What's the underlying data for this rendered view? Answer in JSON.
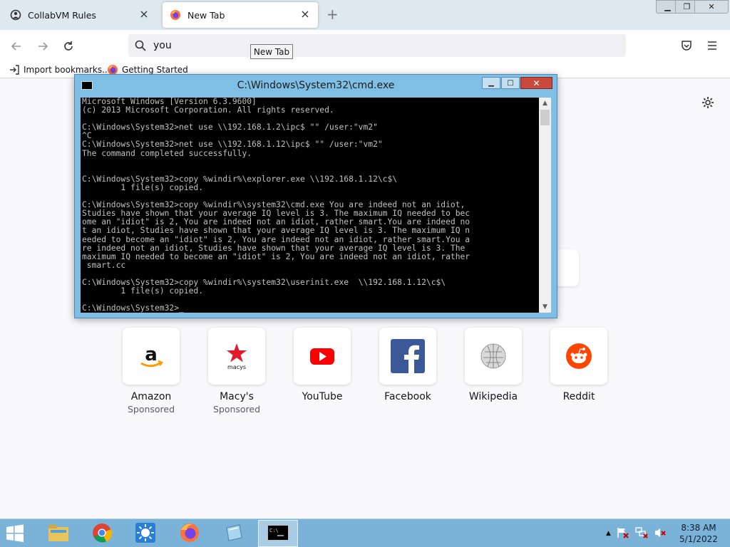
{
  "browser": {
    "tabs": [
      {
        "title": "CollabVM Rules",
        "icon": "collabvm-icon"
      },
      {
        "title": "New Tab",
        "icon": "firefox-icon"
      }
    ],
    "url_value": "you",
    "tooltip": "New Tab",
    "bookmarks": [
      {
        "label": "Import bookmarks...",
        "icon": "import-icon"
      },
      {
        "label": "Getting Started",
        "icon": "firefox-icon"
      }
    ]
  },
  "shortcuts": [
    {
      "title": "Amazon",
      "sponsor": "Sponsored",
      "icon": "amazon-logo"
    },
    {
      "title": "Macy's",
      "sponsor": "Sponsored",
      "icon": "macys-logo",
      "logo_text": "macys"
    },
    {
      "title": "YouTube",
      "sponsor": "",
      "icon": "youtube-logo"
    },
    {
      "title": "Facebook",
      "sponsor": "",
      "icon": "facebook-logo"
    },
    {
      "title": "Wikipedia",
      "sponsor": "",
      "icon": "wikipedia-logo"
    },
    {
      "title": "Reddit",
      "sponsor": "",
      "icon": "reddit-logo"
    }
  ],
  "cmd": {
    "title": "C:\\Windows\\System32\\cmd.exe",
    "output": "Microsoft Windows [Version 6.3.9600]\n(c) 2013 Microsoft Corporation. All rights reserved.\n\nC:\\Windows\\System32>net use \\\\192.168.1.2\\ipc$ \"\" /user:\"vm2\"\n^C\nC:\\Windows\\System32>net use \\\\192.168.1.12\\ipc$ \"\" /user:\"vm2\"\nThe command completed successfully.\n\n\nC:\\Windows\\System32>copy %windir%\\explorer.exe \\\\192.168.1.12\\c$\\\n        1 file(s) copied.\n\nC:\\Windows\\System32>copy %windir%\\system32\\cmd.exe You are indeed not an idiot,\nStudies have shown that your average IQ level is 3. The maximum IQ needed to bec\nome an \"idiot\" is 2, You are indeed not an idiot, rather smart.You are indeed no\nt an idiot, Studies have shown that your average IQ level is 3. The maximum IQ n\needed to become an \"idiot\" is 2, You are indeed not an idiot, rather smart.You a\nre indeed not an idiot, Studies have shown that your average IQ level is 3. The\nmaximum IQ needed to become an \"idiot\" is 2, You are indeed not an idiot, rather\n smart.cc\n\nC:\\Windows\\System32>copy %windir%\\system32\\userinit.exe  \\\\192.168.1.12\\c$\\\n        1 file(s) copied.\n\nC:\\Windows\\System32>_"
  },
  "taskbar": {
    "apps": [
      {
        "name": "file-explorer",
        "icon": "folder-icon"
      },
      {
        "name": "chrome",
        "icon": "chrome-icon"
      },
      {
        "name": "unknown-app",
        "icon": "sun-icon"
      },
      {
        "name": "firefox",
        "icon": "firefox-icon"
      },
      {
        "name": "app-window",
        "icon": "window-icon"
      },
      {
        "name": "cmd",
        "icon": "cmd-icon"
      }
    ],
    "time": "8:38 AM",
    "date": "5/1/2022"
  },
  "colors": {
    "tabstrip": "#dde8ef",
    "cmd_frame": "#7fbfe6",
    "taskbar": "#7ab2d8",
    "console_text": "#c0c0c0"
  }
}
